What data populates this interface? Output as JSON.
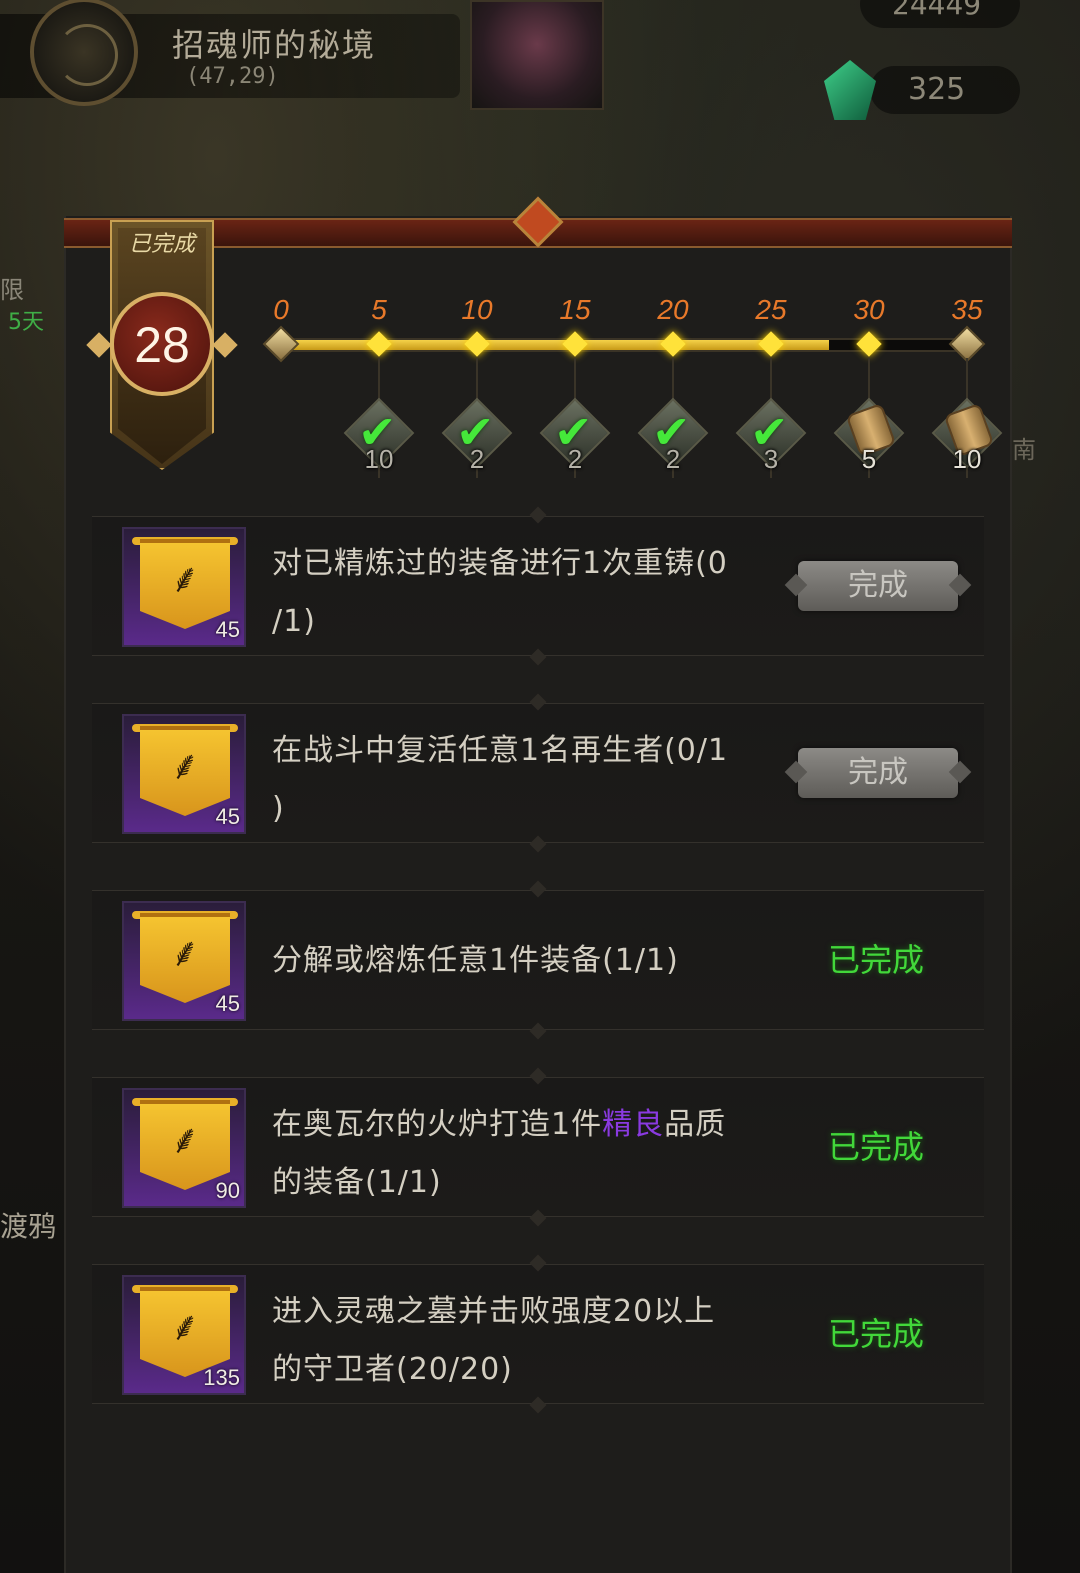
{
  "header": {
    "location_name": "招魂师的秘境",
    "coords": "(47,29)",
    "resource_top": "24449",
    "resource_gem": "325"
  },
  "side": {
    "left_label_1": "限",
    "left_timer": "5天",
    "left_label_3": "渡鸦",
    "right_label": "南"
  },
  "badge": {
    "label": "已完成",
    "level": "28"
  },
  "progress": {
    "current": 28,
    "max": 35,
    "ticks": [
      "0",
      "5",
      "10",
      "15",
      "20",
      "25",
      "30",
      "35"
    ]
  },
  "rewards": [
    {
      "count": "10",
      "claimed": true
    },
    {
      "count": "2",
      "claimed": true
    },
    {
      "count": "2",
      "claimed": true
    },
    {
      "count": "2",
      "claimed": true
    },
    {
      "count": "3",
      "claimed": true
    },
    {
      "count": "5",
      "claimed": false
    },
    {
      "count": "10",
      "claimed": false
    }
  ],
  "tasks": [
    {
      "line1": "对已精炼过的装备进行1次重铸(0",
      "line2": "/1)",
      "points": "45",
      "status": "完成"
    },
    {
      "line1": "在战斗中复活任意1名再生者(0/1",
      "line2": ")",
      "points": "45",
      "status": "完成"
    },
    {
      "line1": "分解或熔炼任意1件装备(1/1)",
      "line2": "",
      "points": "45",
      "status": "已完成"
    },
    {
      "line1a": "在奥瓦尔的火炉打造1件",
      "line1b": "精良",
      "line1c": "品质",
      "line2": "的装备(1/1)",
      "points": "90",
      "status": "已完成"
    },
    {
      "line1": "进入灵魂之墓并击败强度20以上",
      "line2": "的守卫者(20/20)",
      "points": "135",
      "status": "已完成"
    }
  ],
  "icons": {
    "task_icon": "gold-banner-icon",
    "reward_claimed": "check-icon",
    "reward_locked": "scroll-icon",
    "gem": "gem-icon"
  },
  "colors": {
    "progress_fill": "#f5d24a",
    "tick_label": "#e8792a",
    "status_done": "#42d83a",
    "highlight_quality": "#8a3ae0"
  }
}
